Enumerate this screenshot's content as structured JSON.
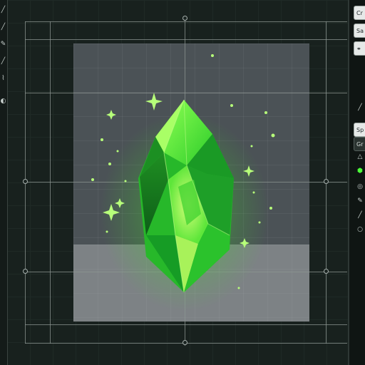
{
  "left_toolbar": {
    "tools": [
      "brush-icon",
      "pen-icon",
      "pencil-icon",
      "eraser-icon",
      "select-icon",
      "bucket-icon"
    ]
  },
  "right_panel": {
    "items": [
      {
        "label": "Cr"
      },
      {
        "label": "Sa"
      },
      {
        "label": "Sp"
      },
      {
        "label": "Gr"
      }
    ]
  },
  "canvas": {
    "artwork": "green-crystal",
    "colors": {
      "crystal_light": "#7dff4a",
      "crystal_mid": "#2ecf2a",
      "crystal_dark": "#0e6b1c",
      "glow": "#5aff3c",
      "artboard_bg": "#4b5256",
      "floor": "#7d8285"
    }
  }
}
